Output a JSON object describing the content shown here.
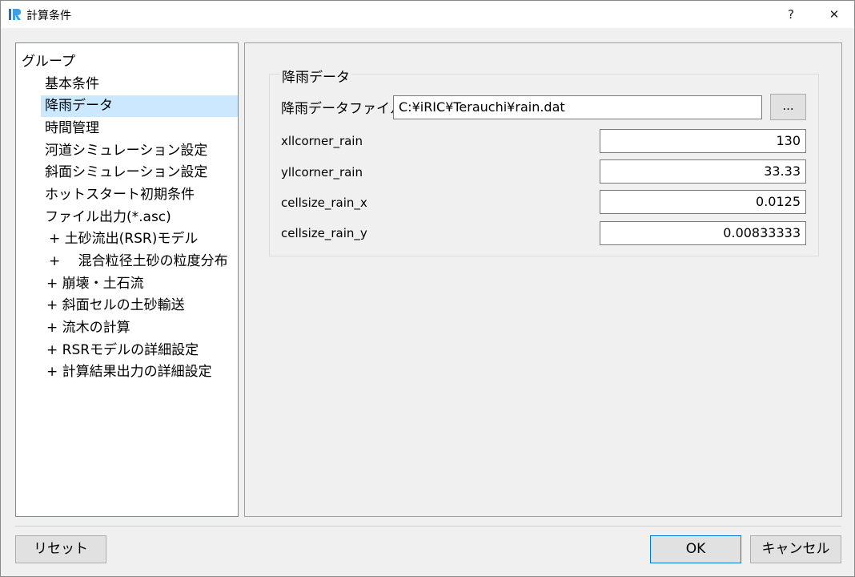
{
  "window": {
    "title": "計算条件",
    "help_glyph": "?",
    "close_glyph": "✕",
    "icon": "iric-app-icon"
  },
  "tree": {
    "root_label": "グループ",
    "items": [
      {
        "label": "基本条件"
      },
      {
        "label": "降雨データ",
        "selected": true
      },
      {
        "label": "時間管理"
      },
      {
        "label": "河道シミュレーション設定"
      },
      {
        "label": "斜面シミュレーション設定"
      },
      {
        "label": "ホットスタート初期条件"
      },
      {
        "label": "ファイル出力(*.asc)"
      },
      {
        "label": "+ 土砂流出(RSR)モデル"
      },
      {
        "label": "+ 　混合粒径土砂の粒度分布"
      },
      {
        "label": "+ 崩壊・土石流"
      },
      {
        "label": "+ 斜面セルの土砂輸送"
      },
      {
        "label": "+ 流木の計算"
      },
      {
        "label": "+ RSRモデルの詳細設定"
      },
      {
        "label": "+ 計算結果出力の詳細設定"
      }
    ]
  },
  "group": {
    "title": "降雨データ",
    "file_label": "降雨データファイル",
    "file_value": "C:¥iRIC¥Terauchi¥rain.dat",
    "browse_label": "...",
    "fields": [
      {
        "label": "xllcorner_rain",
        "value": "130"
      },
      {
        "label": "yllcorner_rain",
        "value": "33.33"
      },
      {
        "label": "cellsize_rain_x",
        "value": "0.0125"
      },
      {
        "label": "cellsize_rain_y",
        "value": "0.00833333"
      }
    ]
  },
  "buttons": {
    "reset": "リセット",
    "ok": "OK",
    "cancel": "キャンセル"
  }
}
